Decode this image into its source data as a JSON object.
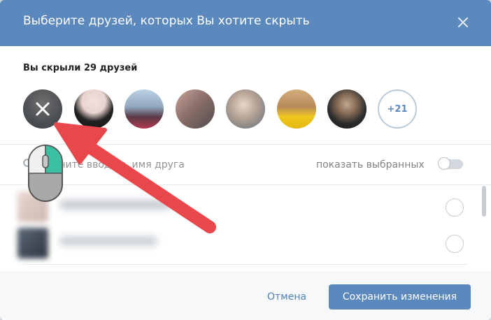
{
  "header": {
    "title": "Выберите друзей, которых Вы хотите скрыть",
    "close_icon": "close-icon",
    "background": "#5b88bd"
  },
  "hidden_section": {
    "title": "Вы скрыли 29 друзей",
    "more_label": "+21"
  },
  "avatars": [
    {
      "name": "avatar-1",
      "colors": [
        "#8a8a8a",
        "#4a4f55"
      ],
      "removable": true
    },
    {
      "name": "avatar-2",
      "colors": [
        "#e8d6d2",
        "#1b1b1b"
      ]
    },
    {
      "name": "avatar-3",
      "colors": [
        "#9fb8d0",
        "#7a3b4a"
      ]
    },
    {
      "name": "avatar-4",
      "colors": [
        "#b98e86",
        "#6a5b57"
      ]
    },
    {
      "name": "avatar-5",
      "colors": [
        "#d9c6b8",
        "#6f7a84"
      ]
    },
    {
      "name": "avatar-6",
      "colors": [
        "#c99a6a",
        "#e8c218"
      ]
    },
    {
      "name": "avatar-7",
      "colors": [
        "#2d2d2d",
        "#b79b84"
      ]
    }
  ],
  "search": {
    "placeholder": "Начните вводить имя друга",
    "show_selected_label": "показать выбранных",
    "toggle_on": false
  },
  "footer": {
    "cancel_label": "Отмена",
    "save_label": "Сохранить изменения"
  },
  "colors": {
    "accent": "#5b88bd",
    "link": "#5181b8",
    "arrow": "#e8474c",
    "mouse_button": "#3cc0a2"
  }
}
